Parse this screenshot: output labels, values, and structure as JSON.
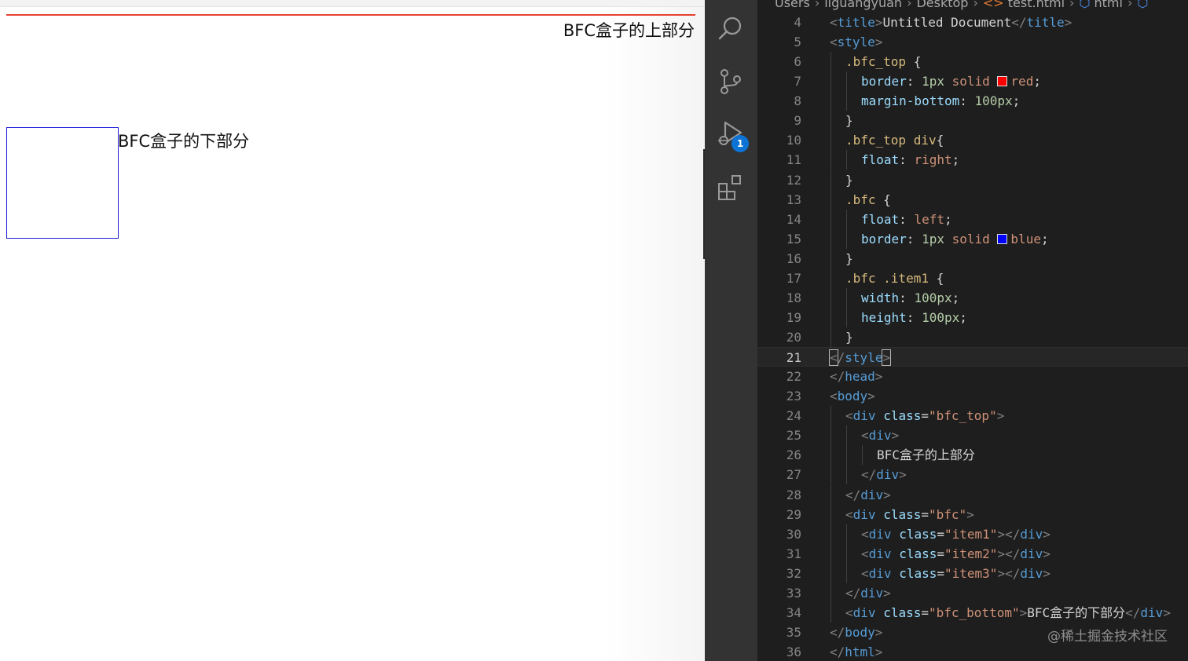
{
  "preview": {
    "top_text": "BFC盒子的上部分",
    "bottom_text": "BFC盒子的下部分"
  },
  "activity_bar": {
    "items": [
      {
        "name": "search-icon"
      },
      {
        "name": "source-control-icon"
      },
      {
        "name": "run-debug-icon",
        "badge": "1"
      },
      {
        "name": "extensions-icon"
      }
    ]
  },
  "editor": {
    "breadcrumb": [
      "Users",
      "liguangyuan",
      "Desktop",
      "test.html",
      "html"
    ],
    "active_line": 21,
    "lines": [
      {
        "n": "4",
        "parts": [
          [
            "t-br",
            "<"
          ],
          [
            "t-tag",
            "title"
          ],
          [
            "t-br",
            ">"
          ],
          [
            "t-txt",
            "Untitled Document"
          ],
          [
            "t-br",
            "</"
          ],
          [
            "t-tag",
            "title"
          ],
          [
            "t-br",
            ">"
          ]
        ],
        "indent": 0
      },
      {
        "n": "5",
        "parts": [
          [
            "t-br",
            "<"
          ],
          [
            "t-tag",
            "style"
          ],
          [
            "t-br",
            ">"
          ]
        ],
        "indent": 0
      },
      {
        "n": "6",
        "parts": [
          [
            "t-sel",
            ".bfc_top"
          ],
          [
            "t-txt",
            " {"
          ]
        ],
        "indent": 1
      },
      {
        "n": "7",
        "parts": [
          [
            "t-prop",
            "border"
          ],
          [
            "t-txt",
            ": "
          ],
          [
            "t-num",
            "1px"
          ],
          [
            "t-txt",
            " "
          ],
          [
            "t-val",
            "solid"
          ],
          [
            "t-txt",
            " "
          ],
          [
            "swatch",
            "#ff0000"
          ],
          [
            "t-val",
            "red"
          ],
          [
            "t-txt",
            ";"
          ]
        ],
        "indent": 2
      },
      {
        "n": "8",
        "parts": [
          [
            "t-prop",
            "margin-bottom"
          ],
          [
            "t-txt",
            ": "
          ],
          [
            "t-num",
            "100px"
          ],
          [
            "t-txt",
            ";"
          ]
        ],
        "indent": 2
      },
      {
        "n": "9",
        "parts": [
          [
            "t-txt",
            "}"
          ]
        ],
        "indent": 1
      },
      {
        "n": "10",
        "parts": [
          [
            "t-sel",
            ".bfc_top div"
          ],
          [
            "t-txt",
            "{"
          ]
        ],
        "indent": 1
      },
      {
        "n": "11",
        "parts": [
          [
            "t-prop",
            "float"
          ],
          [
            "t-txt",
            ": "
          ],
          [
            "t-val",
            "right"
          ],
          [
            "t-txt",
            ";"
          ]
        ],
        "indent": 2
      },
      {
        "n": "12",
        "parts": [
          [
            "t-txt",
            "}"
          ]
        ],
        "indent": 1
      },
      {
        "n": "13",
        "parts": [
          [
            "t-sel",
            ".bfc"
          ],
          [
            "t-txt",
            " {"
          ]
        ],
        "indent": 1
      },
      {
        "n": "14",
        "parts": [
          [
            "t-prop",
            "float"
          ],
          [
            "t-txt",
            ": "
          ],
          [
            "t-val",
            "left"
          ],
          [
            "t-txt",
            ";"
          ]
        ],
        "indent": 2
      },
      {
        "n": "15",
        "parts": [
          [
            "t-prop",
            "border"
          ],
          [
            "t-txt",
            ": "
          ],
          [
            "t-num",
            "1px"
          ],
          [
            "t-txt",
            " "
          ],
          [
            "t-val",
            "solid"
          ],
          [
            "t-txt",
            " "
          ],
          [
            "swatch",
            "#0000ff"
          ],
          [
            "t-val",
            "blue"
          ],
          [
            "t-txt",
            ";"
          ]
        ],
        "indent": 2
      },
      {
        "n": "16",
        "parts": [
          [
            "t-txt",
            "}"
          ]
        ],
        "indent": 1
      },
      {
        "n": "17",
        "parts": [
          [
            "t-sel",
            ".bfc .item1"
          ],
          [
            "t-txt",
            " {"
          ]
        ],
        "indent": 1
      },
      {
        "n": "18",
        "parts": [
          [
            "t-prop",
            "width"
          ],
          [
            "t-txt",
            ": "
          ],
          [
            "t-num",
            "100px"
          ],
          [
            "t-txt",
            ";"
          ]
        ],
        "indent": 2
      },
      {
        "n": "19",
        "parts": [
          [
            "t-prop",
            "height"
          ],
          [
            "t-txt",
            ": "
          ],
          [
            "t-num",
            "100px"
          ],
          [
            "t-txt",
            ";"
          ]
        ],
        "indent": 2
      },
      {
        "n": "20",
        "parts": [
          [
            "t-txt",
            "}"
          ]
        ],
        "indent": 1
      },
      {
        "n": "21",
        "parts": [
          [
            "t-brc",
            "<"
          ],
          [
            "t-br",
            "/"
          ],
          [
            "t-tag",
            "style"
          ],
          [
            "t-brc",
            ">"
          ]
        ],
        "indent": 0
      },
      {
        "n": "22",
        "parts": [
          [
            "t-br",
            "</"
          ],
          [
            "t-tag",
            "head"
          ],
          [
            "t-br",
            ">"
          ]
        ],
        "indent": 0
      },
      {
        "n": "23",
        "parts": [
          [
            "t-br",
            "<"
          ],
          [
            "t-tag",
            "body"
          ],
          [
            "t-br",
            ">"
          ]
        ],
        "indent": 0
      },
      {
        "n": "24",
        "parts": [
          [
            "t-br",
            "<"
          ],
          [
            "t-tag",
            "div"
          ],
          [
            "t-txt",
            " "
          ],
          [
            "t-attr",
            "class"
          ],
          [
            "t-txt",
            "="
          ],
          [
            "t-str",
            "\"bfc_top\""
          ],
          [
            "t-br",
            ">"
          ]
        ],
        "indent": 1
      },
      {
        "n": "25",
        "parts": [
          [
            "t-br",
            "<"
          ],
          [
            "t-tag",
            "div"
          ],
          [
            "t-br",
            ">"
          ]
        ],
        "indent": 2
      },
      {
        "n": "26",
        "parts": [
          [
            "t-txt",
            "BFC盒子的上部分"
          ]
        ],
        "indent": 3
      },
      {
        "n": "27",
        "parts": [
          [
            "t-br",
            "</"
          ],
          [
            "t-tag",
            "div"
          ],
          [
            "t-br",
            ">"
          ]
        ],
        "indent": 2
      },
      {
        "n": "28",
        "parts": [
          [
            "t-br",
            "</"
          ],
          [
            "t-tag",
            "div"
          ],
          [
            "t-br",
            ">"
          ]
        ],
        "indent": 1
      },
      {
        "n": "29",
        "parts": [
          [
            "t-br",
            "<"
          ],
          [
            "t-tag",
            "div"
          ],
          [
            "t-txt",
            " "
          ],
          [
            "t-attr",
            "class"
          ],
          [
            "t-txt",
            "="
          ],
          [
            "t-str",
            "\"bfc\""
          ],
          [
            "t-br",
            ">"
          ]
        ],
        "indent": 1
      },
      {
        "n": "30",
        "parts": [
          [
            "t-br",
            "<"
          ],
          [
            "t-tag",
            "div"
          ],
          [
            "t-txt",
            " "
          ],
          [
            "t-attr",
            "class"
          ],
          [
            "t-txt",
            "="
          ],
          [
            "t-str",
            "\"item1\""
          ],
          [
            "t-br",
            "></"
          ],
          [
            "t-tag",
            "div"
          ],
          [
            "t-br",
            ">"
          ]
        ],
        "indent": 2
      },
      {
        "n": "31",
        "parts": [
          [
            "t-br",
            "<"
          ],
          [
            "t-tag",
            "div"
          ],
          [
            "t-txt",
            " "
          ],
          [
            "t-attr",
            "class"
          ],
          [
            "t-txt",
            "="
          ],
          [
            "t-str",
            "\"item2\""
          ],
          [
            "t-br",
            "></"
          ],
          [
            "t-tag",
            "div"
          ],
          [
            "t-br",
            ">"
          ]
        ],
        "indent": 2
      },
      {
        "n": "32",
        "parts": [
          [
            "t-br",
            "<"
          ],
          [
            "t-tag",
            "div"
          ],
          [
            "t-txt",
            " "
          ],
          [
            "t-attr",
            "class"
          ],
          [
            "t-txt",
            "="
          ],
          [
            "t-str",
            "\"item3\""
          ],
          [
            "t-br",
            "></"
          ],
          [
            "t-tag",
            "div"
          ],
          [
            "t-br",
            ">"
          ]
        ],
        "indent": 2
      },
      {
        "n": "33",
        "parts": [
          [
            "t-br",
            "</"
          ],
          [
            "t-tag",
            "div"
          ],
          [
            "t-br",
            ">"
          ]
        ],
        "indent": 1
      },
      {
        "n": "34",
        "parts": [
          [
            "t-br",
            "<"
          ],
          [
            "t-tag",
            "div"
          ],
          [
            "t-txt",
            " "
          ],
          [
            "t-attr",
            "class"
          ],
          [
            "t-txt",
            "="
          ],
          [
            "t-str",
            "\"bfc_bottom\""
          ],
          [
            "t-br",
            ">"
          ],
          [
            "t-txt",
            "BFC盒子的下部分"
          ],
          [
            "t-br",
            "</"
          ],
          [
            "t-tag",
            "div"
          ],
          [
            "t-br",
            ">"
          ]
        ],
        "indent": 1
      },
      {
        "n": "35",
        "parts": [
          [
            "t-br",
            "</"
          ],
          [
            "t-tag",
            "body"
          ],
          [
            "t-br",
            ">"
          ]
        ],
        "indent": 0
      },
      {
        "n": "36",
        "parts": [
          [
            "t-br",
            "</"
          ],
          [
            "t-tag",
            "html"
          ],
          [
            "t-br",
            ">"
          ]
        ],
        "indent": 0
      }
    ]
  },
  "watermark": "@稀土掘金技术社区"
}
